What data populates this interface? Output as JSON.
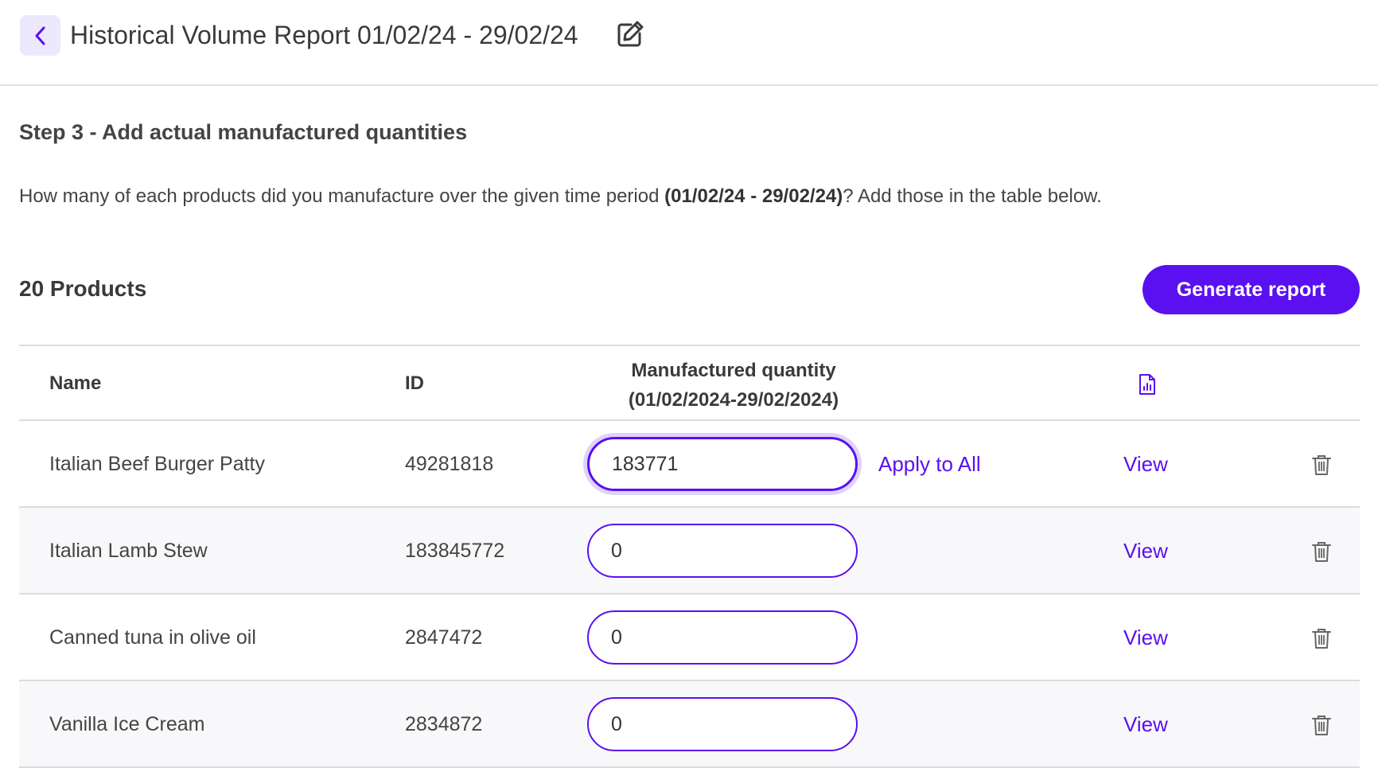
{
  "header": {
    "title": "Historical Volume Report 01/02/24 - 29/02/24",
    "back_icon": "chevron-left-icon",
    "edit_icon": "edit-pencil-icon"
  },
  "step": {
    "title": "Step 3 - Add actual manufactured quantities",
    "description_prefix": "How many of each products did you manufacture over the given time period ",
    "description_period": "(01/02/24 - 29/02/24)",
    "description_suffix": "? Add those in the table below."
  },
  "products": {
    "count_label": "20 Products",
    "generate_label": "Generate report"
  },
  "table": {
    "headers": {
      "name": "Name",
      "id": "ID",
      "qty_line1": "Manufactured quantity",
      "qty_line2": "(01/02/2024-29/02/2024)",
      "doc_icon": "report-document-icon"
    },
    "apply_all_label": "Apply to All",
    "view_label": "View",
    "delete_icon": "trash-icon",
    "rows": [
      {
        "name": "Italian Beef Burger Patty",
        "id": "49281818",
        "quantity": "183771"
      },
      {
        "name": "Italian Lamb Stew",
        "id": "183845772",
        "quantity": "0"
      },
      {
        "name": "Canned tuna in olive oil",
        "id": "2847472",
        "quantity": "0"
      },
      {
        "name": "Vanilla Ice Cream",
        "id": "2834872",
        "quantity": "0"
      }
    ]
  },
  "colors": {
    "accent": "#5a10f0",
    "back_button_bg": "#ebe9fb",
    "alt_row_bg": "#f8f8fa",
    "divider": "#dcdce0"
  }
}
